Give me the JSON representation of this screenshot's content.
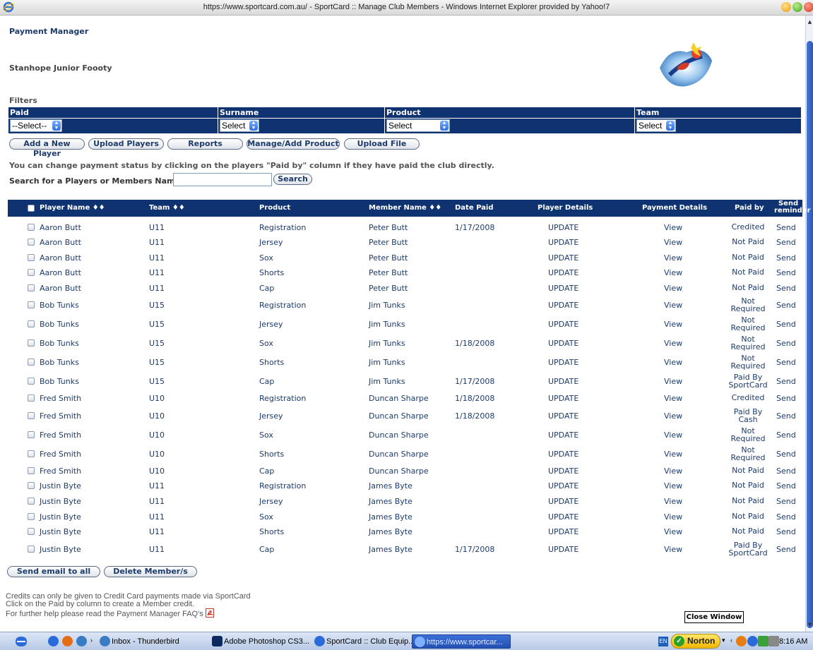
{
  "window": {
    "title": "https://www.sportcard.com.au/ - SportCard :: Manage Club Members - Windows Internet Explorer provided by Yahoo!7"
  },
  "page": {
    "title": "Payment Manager",
    "club_name": "Stanhope Junior Foooty",
    "filters_label": "Filters"
  },
  "filters": [
    {
      "label": "Paid",
      "value": "--Select--"
    },
    {
      "label": "Surname",
      "value": "Select"
    },
    {
      "label": "Product",
      "value": "Select"
    },
    {
      "label": "Team",
      "value": "Select"
    }
  ],
  "actions": {
    "add_player": "Add a New Player",
    "upload_players": "Upload Players",
    "reports": "Reports",
    "manage_product": "Manage/Add Product",
    "upload_file": "Upload File"
  },
  "info_text": "You can change payment status by clicking on the players \"Paid by\" column if they have paid the club directly.",
  "search": {
    "label": "Search for a Players or Members Name",
    "value": "",
    "button": "Search"
  },
  "table": {
    "headers": {
      "player_name": "Player Name ♦♦",
      "team": "Team ♦♦",
      "product": "Product",
      "member_name": "Member Name ♦♦",
      "date_paid": "Date Paid",
      "player_details": "Player Details",
      "payment_details": "Payment Details",
      "paid_by": "Paid by",
      "send_reminder_1": "Send",
      "send_reminder_2": "reminder"
    },
    "rows": [
      {
        "player": "Aaron Butt",
        "team": "U11",
        "product": "Registration",
        "member": "Peter Butt",
        "date": "1/17/2008",
        "details": "UPDATE",
        "payment": "View",
        "paid_by": [
          "Credited"
        ],
        "send": "Send"
      },
      {
        "player": "Aaron Butt",
        "team": "U11",
        "product": "Jersey",
        "member": "Peter Butt",
        "date": "",
        "details": "UPDATE",
        "payment": "View",
        "paid_by": [
          "Not Paid"
        ],
        "send": "Send"
      },
      {
        "player": "Aaron Butt",
        "team": "U11",
        "product": "Sox",
        "member": "Peter Butt",
        "date": "",
        "details": "UPDATE",
        "payment": "View",
        "paid_by": [
          "Not Paid"
        ],
        "send": "Send"
      },
      {
        "player": "Aaron Butt",
        "team": "U11",
        "product": "Shorts",
        "member": "Peter Butt",
        "date": "",
        "details": "UPDATE",
        "payment": "View",
        "paid_by": [
          "Not Paid"
        ],
        "send": "Send"
      },
      {
        "player": "Aaron Butt",
        "team": "U11",
        "product": "Cap",
        "member": "Peter Butt",
        "date": "",
        "details": "UPDATE",
        "payment": "View",
        "paid_by": [
          "Not Paid"
        ],
        "send": "Send"
      },
      {
        "player": "Bob  Tunks",
        "team": "U15",
        "product": "Registration",
        "member": "Jim Tunks",
        "date": "",
        "details": "UPDATE",
        "payment": "View",
        "paid_by": [
          "Not",
          "Required"
        ],
        "send": "Send"
      },
      {
        "player": "Bob  Tunks",
        "team": "U15",
        "product": "Jersey",
        "member": "Jim Tunks",
        "date": "",
        "details": "UPDATE",
        "payment": "View",
        "paid_by": [
          "Not",
          "Required"
        ],
        "send": "Send"
      },
      {
        "player": "Bob  Tunks",
        "team": "U15",
        "product": "Sox",
        "member": "Jim Tunks",
        "date": "1/18/2008",
        "details": "UPDATE",
        "payment": "View",
        "paid_by": [
          "Not",
          "Required"
        ],
        "send": "Send"
      },
      {
        "player": "Bob  Tunks",
        "team": "U15",
        "product": "Shorts",
        "member": "Jim Tunks",
        "date": "",
        "details": "UPDATE",
        "payment": "View",
        "paid_by": [
          "Not",
          "Required"
        ],
        "send": "Send"
      },
      {
        "player": "Bob  Tunks",
        "team": "U15",
        "product": "Cap",
        "member": "Jim Tunks",
        "date": "1/17/2008",
        "details": "UPDATE",
        "payment": "View",
        "paid_by": [
          "Paid By",
          "SportCard"
        ],
        "send": "Send"
      },
      {
        "player": "Fred Smith",
        "team": "U10",
        "product": "Registration",
        "member": "Duncan Sharpe",
        "date": "1/18/2008",
        "details": "UPDATE",
        "payment": "View",
        "paid_by": [
          "Credited"
        ],
        "send": "Send"
      },
      {
        "player": "Fred Smith",
        "team": "U10",
        "product": "Jersey",
        "member": "Duncan Sharpe",
        "date": "1/18/2008",
        "details": "UPDATE",
        "payment": "View",
        "paid_by": [
          "Paid By",
          "Cash"
        ],
        "send": "Send"
      },
      {
        "player": "Fred Smith",
        "team": "U10",
        "product": "Sox",
        "member": "Duncan Sharpe",
        "date": "",
        "details": "UPDATE",
        "payment": "View",
        "paid_by": [
          "Not",
          "Required"
        ],
        "send": "Send"
      },
      {
        "player": "Fred Smith",
        "team": "U10",
        "product": "Shorts",
        "member": "Duncan Sharpe",
        "date": "",
        "details": "UPDATE",
        "payment": "View",
        "paid_by": [
          "Not",
          "Required"
        ],
        "send": "Send"
      },
      {
        "player": "Fred Smith",
        "team": "U10",
        "product": "Cap",
        "member": "Duncan Sharpe",
        "date": "",
        "details": "UPDATE",
        "payment": "View",
        "paid_by": [
          "Not Paid"
        ],
        "send": "Send"
      },
      {
        "player": "Justin Byte",
        "team": "U11",
        "product": "Registration",
        "member": "James Byte",
        "date": "",
        "details": "UPDATE",
        "payment": "View",
        "paid_by": [
          "Not Paid"
        ],
        "send": "Send"
      },
      {
        "player": "Justin Byte",
        "team": "U11",
        "product": "Jersey",
        "member": "James Byte",
        "date": "",
        "details": "UPDATE",
        "payment": "View",
        "paid_by": [
          "Not Paid"
        ],
        "send": "Send"
      },
      {
        "player": "Justin Byte",
        "team": "U11",
        "product": "Sox",
        "member": "James Byte",
        "date": "",
        "details": "UPDATE",
        "payment": "View",
        "paid_by": [
          "Not Paid"
        ],
        "send": "Send"
      },
      {
        "player": "Justin Byte",
        "team": "U11",
        "product": "Shorts",
        "member": "James Byte",
        "date": "",
        "details": "UPDATE",
        "payment": "View",
        "paid_by": [
          "Not Paid"
        ],
        "send": "Send"
      },
      {
        "player": "Justin Byte",
        "team": "U11",
        "product": "Cap",
        "member": "James Byte",
        "date": "1/17/2008",
        "details": "UPDATE",
        "payment": "View",
        "paid_by": [
          "Paid By",
          "SportCard"
        ],
        "send": "Send"
      }
    ]
  },
  "bulk_actions": {
    "send_email_all": "Send email to all",
    "delete_members": "Delete Member/s"
  },
  "footer": {
    "line1": "Credits can only be given to Credit Card payments made via SportCard",
    "line2": "Click on the Paid by column to create a Member credit.",
    "line3": "For further help please read the Payment Manager FAQ's",
    "close_window": "Close Window"
  },
  "taskbar": {
    "thunderbird": "Inbox - Thunderbird",
    "photoshop": "Adobe Photoshop CS3...",
    "club_equip": "SportCard :: Club Equip...",
    "active_window": "https://www.sportcar...",
    "norton": "Norton",
    "lang": "EN",
    "time": "8:16 AM"
  },
  "colors": {
    "header_navy": "#0e3370",
    "link_blue": "#1d3b6b"
  }
}
